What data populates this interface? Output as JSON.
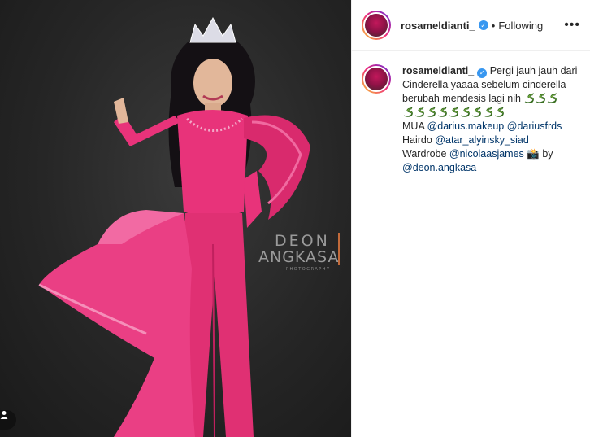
{
  "post": {
    "username": "rosameldianti_",
    "separator": "•",
    "follow_status": "Following",
    "more_icon": "•••"
  },
  "caption": {
    "username": "rosameldianti_",
    "text_1": "Pergi jauh jauh dari Cinderella yaaaa sebelum cinderella berubah mendesis lagi nih",
    "emoji": "snake",
    "emoji_count_line1": 3,
    "emoji_count_line2": 9,
    "mua_label": "MUA",
    "mua_1": "@darius.makeup",
    "mua_2": "@dariusfrds",
    "hairdo_label": "Hairdo",
    "hairdo": "@atar_alyinsky_siad",
    "wardrobe_label": "Wardrobe",
    "wardrobe": "@nicolaasjames",
    "camera_emoji": "📸",
    "by_label": "by",
    "photographer": "@deon.angkasa"
  },
  "watermark": {
    "line1": "DEON",
    "line2": "ANGKASA",
    "line3": "PHOTOGRAPHY"
  },
  "colors": {
    "dress": "#e8337a",
    "background": "#2a2a2a",
    "link": "#003569",
    "verified": "#3897f0"
  }
}
